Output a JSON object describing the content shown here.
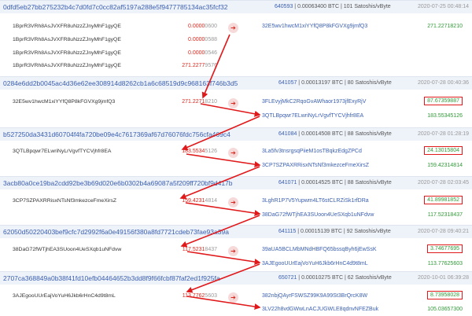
{
  "transactions": [
    {
      "hash": "0dfd5eb27bb275232b4c7d0fd7c0cc82af5197a288e5f9477785134ac35fcf32",
      "block": "640593",
      "fee": "0.00063400 BTC",
      "rate": "101 Satoshis/vByte",
      "date": "2020-07-25 00:48:14",
      "inputs": [
        {
          "address": "1BprR3VRh8AsJVXFR8uNzzZJnyMhF1gyQE",
          "amount_big": "0.0000",
          "amount_small": "0600"
        },
        {
          "address": "1BprR3VRh8AsJVXFR8uNzzZJnyMhF1gyQE",
          "amount_big": "0.0000",
          "amount_small": "0588"
        },
        {
          "address": "1BprR3VRh8AsJVXFR8uNzzZJnyMhF1gyQE",
          "amount_big": "0.0000",
          "amount_small": "0546"
        },
        {
          "address": "1BprR3VRh8AsJVXFR8uNzzZJnyMhF1gyQE",
          "amount_big": "271.2277",
          "amount_small": "9576"
        }
      ],
      "outputs": [
        {
          "address": "32E5wv1hwcM1xiYYfQ8P8kFGVXg9jmfQ3",
          "amount": "271.22718210",
          "boxed": false
        }
      ]
    },
    {
      "hash": "0284e6dd2b0045ac4d36e62ee308914d8262cb1a6c68519d9c968163f746b3d5",
      "block": "641057",
      "fee": "0.00013197 BTC",
      "rate": "80 Satoshis/vByte",
      "date": "2020-07-28 00:40:36",
      "inputs": [
        {
          "address": "32E5wv1hwcM1xiYYfQ8P8kFGVXg9jmfQ3",
          "amount_big": "271.2271",
          "amount_small": "8210"
        }
      ],
      "outputs": [
        {
          "address": "3FLEvyjMkC2RqoGvAWhaor1973jfExyRjV",
          "amount": "87.67359887",
          "boxed": true
        },
        {
          "address": "3QTLBpqwr7ELwriNyLrVgvfTYCVjhfr8EA",
          "amount": "183.55345126",
          "boxed": false
        }
      ]
    },
    {
      "hash": "b527250da3431d60704f4fa720be09e4c7617369af67d76076fdc756cfa469c4",
      "block": "641084",
      "fee": "0.00014508 BTC",
      "rate": "88 Satoshis/vByte",
      "date": "2020-07-28 01:28:19",
      "inputs": [
        {
          "address": "3QTLBpqwr7ELwriNyLrVgvfTYCVjhfr8EA",
          "amount_big": "183.5534",
          "amount_small": "5126"
        }
      ],
      "outputs": [
        {
          "address": "3La5fv3tnsrgsqPiieM1osTBqkzEdgZPCd",
          "amount": "24.13015804",
          "boxed": true
        },
        {
          "address": "3CP7SZPAXRRisxNTsNf3mkezceFmeXirsZ",
          "amount": "159.42314814",
          "boxed": false
        }
      ]
    },
    {
      "hash": "3acb80a0ce19ba2cdd92be3b69d020e6b0302b4a69087a5f209ff720bf9d417b",
      "block": "641071",
      "fee": "0.00014525 BTC",
      "rate": "88 Satoshis/vByte",
      "date": "2020-07-28 02:03:45",
      "inputs": [
        {
          "address": "3CP7SZPAXRRisxNTsNf3mkezceFmeXirsZ",
          "amount_big": "159.4231",
          "amount_small": "4814"
        }
      ],
      "outputs": [
        {
          "address": "3LghR1P7V5Yupwm4LT6stCLRZiSk1rfDRa",
          "amount": "41.89981852",
          "boxed": true
        },
        {
          "address": "38DaG72fWTjhEA3SUoon4UeSXqb1uNFdvw",
          "amount": "117.52318437",
          "boxed": false
        }
      ]
    },
    {
      "hash": "62050d50220403bef9cfc7d2992f6a0e49156f380a8fd7721cdeb73fae93a39a",
      "block": "641115",
      "fee": "0.00015139 BTC",
      "rate": "92 Satoshis/vByte",
      "date": "2020-07-28 09:40:21",
      "inputs": [
        {
          "address": "38DaG72fWTjhEA3SUoon4UeSXqb1uNFdvw",
          "amount_big": "117.5231",
          "amount_small": "8437"
        }
      ],
      "outputs": [
        {
          "address": "39aUA5BCLMbMNdHBFQ65bssqByh6jEwSsK",
          "amount": "3.74677695",
          "boxed": true
        },
        {
          "address": "3AJEgooUUrEajVoYuH6Jkb6rHnC4d9t8mL",
          "amount": "113.77625603",
          "boxed": false
        }
      ]
    },
    {
      "hash": "2707ca368849a0b38f41fd10efb04464652b3dd8f9f66fcbf87faf2ed1f925fa",
      "block": "650721",
      "fee": "0.00010275 BTC",
      "rate": "62 Satoshis/vByte",
      "date": "2020-10-01 06:39:28",
      "inputs": [
        {
          "address": "3AJEgooUUrEajVoYuH6Jkb6rHnC4d9t8mL",
          "amount_big": "113.7762",
          "amount_small": "5603"
        }
      ],
      "outputs": [
        {
          "address": "382nbjQAyrFSWSZ99K9A99St3BrQrcK8W",
          "amount": "8.73958028",
          "boxed": true
        },
        {
          "address": "3LV22h8vdGWwLnACJUGWLE8qdnvNFEZBuk",
          "amount": "105.03657300",
          "boxed": false
        }
      ]
    }
  ],
  "icons": {
    "flow_arrow": "arrow-right-icon",
    "flow_glyph": "➔"
  },
  "colors": {
    "link": "#3a5fb0",
    "amount_red": "#d9261c",
    "amount_green": "#2f9a36",
    "highlight": "#e0191b",
    "header_bg": "#eef2f9"
  }
}
